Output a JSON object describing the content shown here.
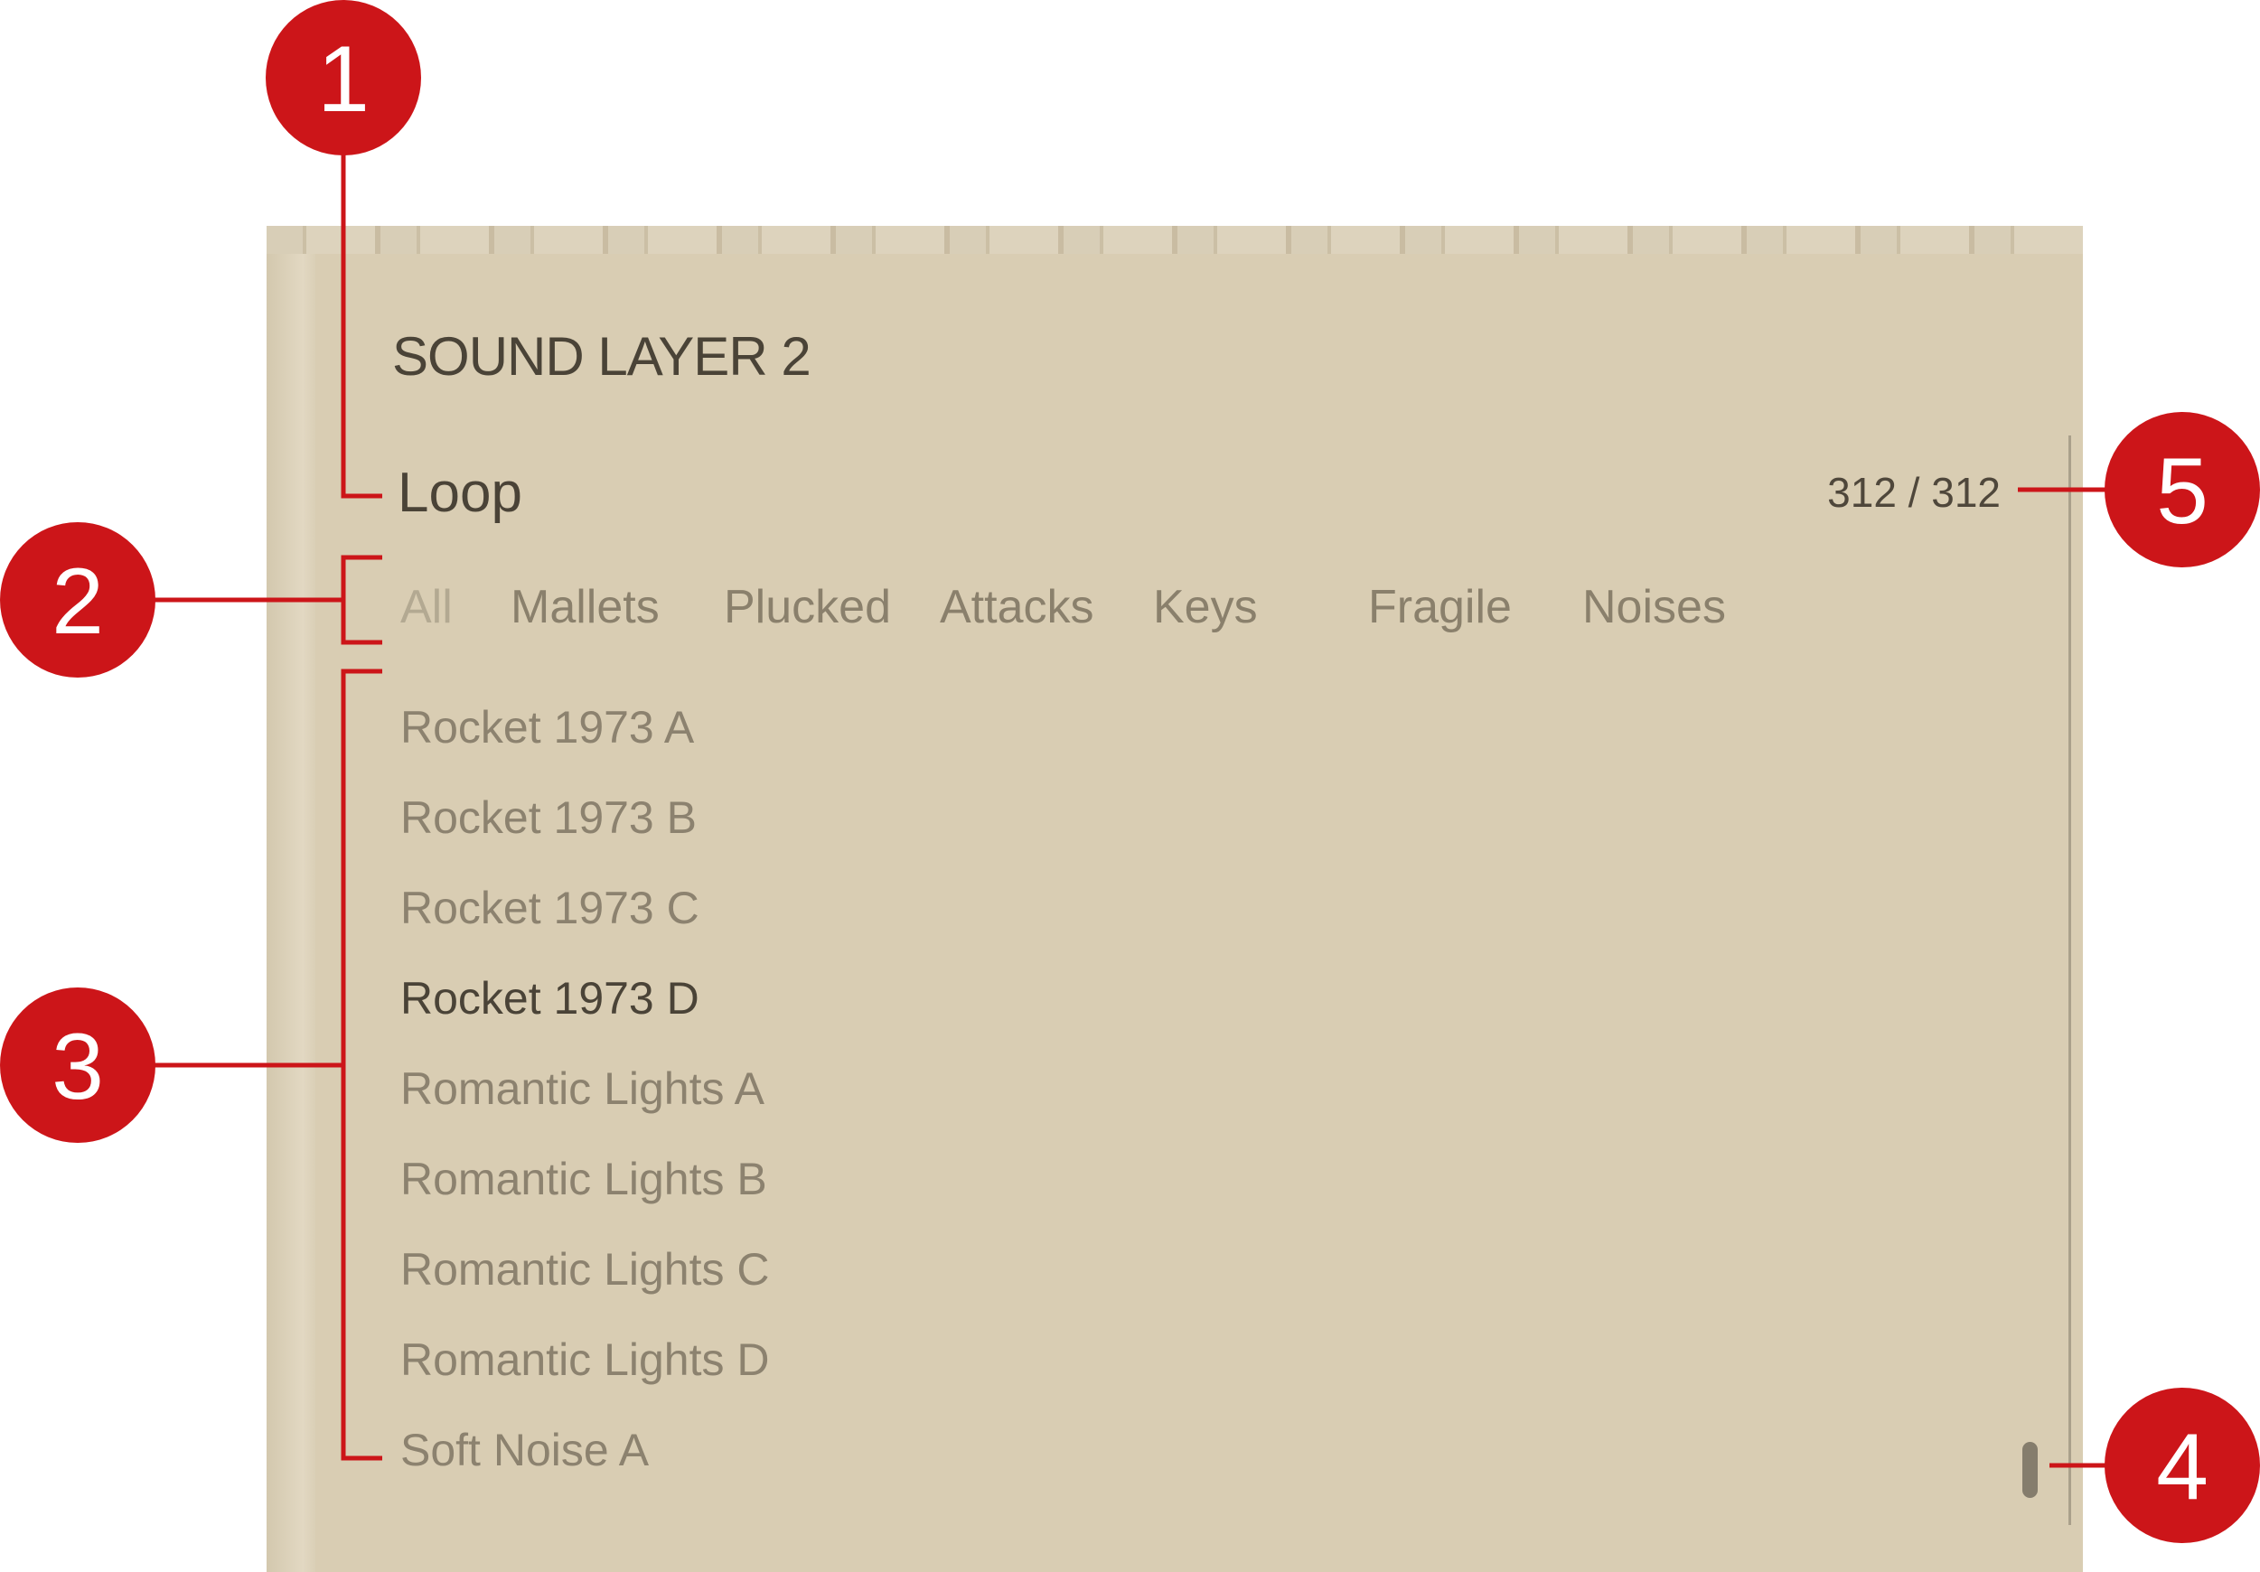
{
  "panel": {
    "title": "SOUND LAYER 2",
    "category": "Loop",
    "count": "312 / 312"
  },
  "tabs": [
    {
      "label": "All",
      "active": true
    },
    {
      "label": "Mallets"
    },
    {
      "label": "Plucked"
    },
    {
      "label": "Attacks"
    },
    {
      "label": "Keys"
    },
    {
      "label": "Fragile"
    },
    {
      "label": "Noises"
    }
  ],
  "items": [
    {
      "label": "Rocket 1973 A"
    },
    {
      "label": "Rocket 1973 B"
    },
    {
      "label": "Rocket 1973 C"
    },
    {
      "label": "Rocket 1973 D",
      "selected": true
    },
    {
      "label": "Romantic Lights A"
    },
    {
      "label": "Romantic Lights B"
    },
    {
      "label": "Romantic Lights C"
    },
    {
      "label": "Romantic Lights D"
    },
    {
      "label": "Soft Noise A"
    }
  ],
  "callouts": [
    "1",
    "2",
    "3",
    "4",
    "5"
  ],
  "colors": {
    "callout": "#cc1519",
    "panel": "#d9cdb3",
    "text": "#4a4337",
    "muted": "#8c826f"
  }
}
